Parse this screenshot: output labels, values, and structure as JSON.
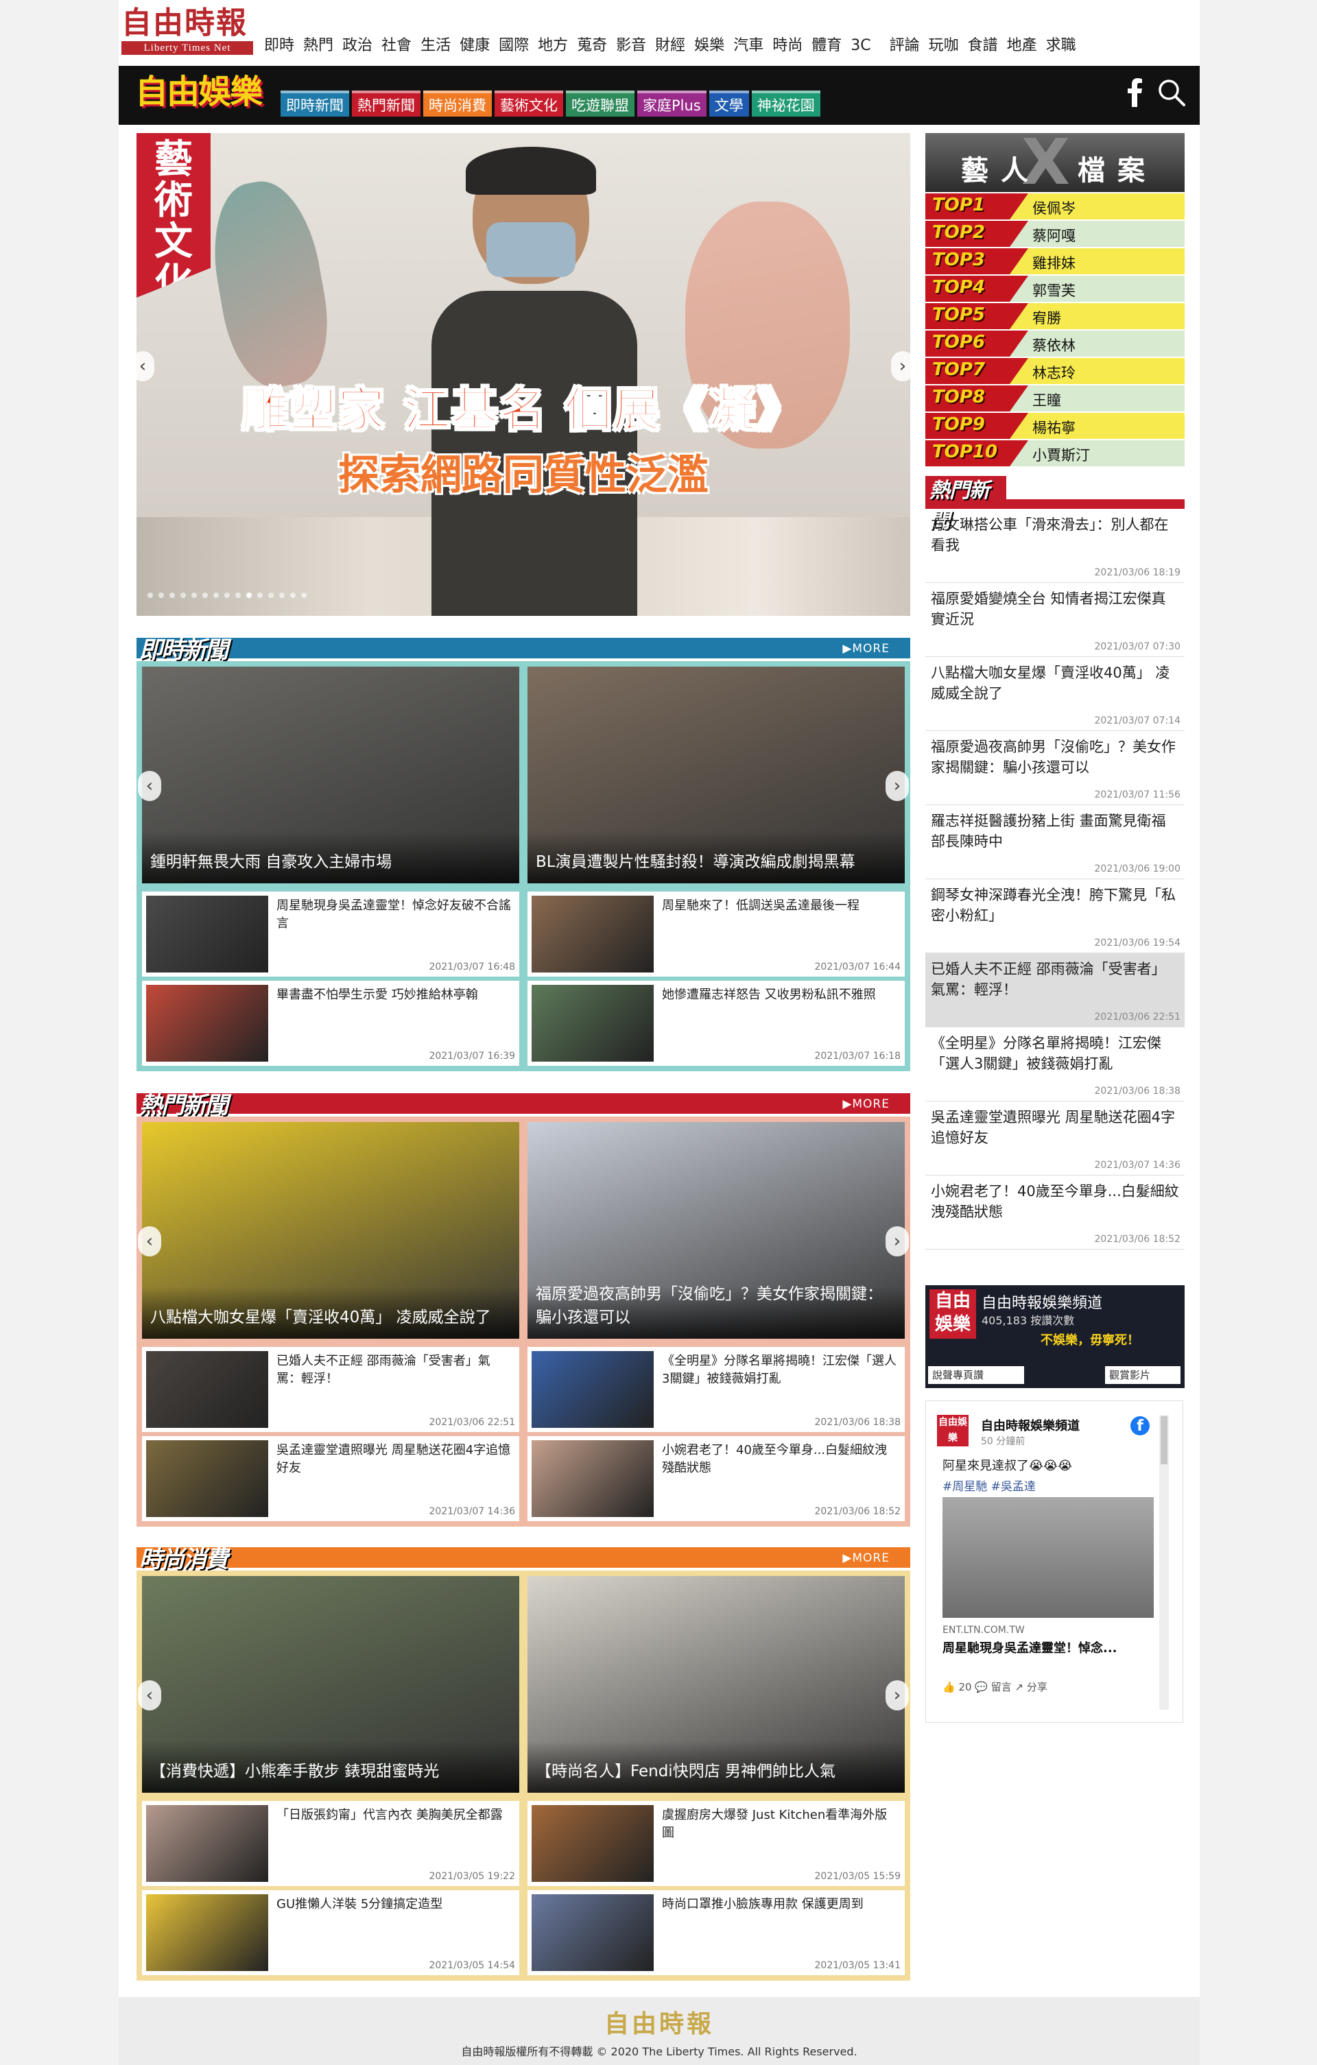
{
  "header": {
    "logo_text": "自由時報",
    "logo_sub": "Liberty Times Net",
    "nav": [
      "即時",
      "熱門",
      "政治",
      "社會",
      "生活",
      "健康",
      "國際",
      "地方",
      "蒐奇",
      "影音",
      "財經",
      "娛樂",
      "汽車",
      "時尚",
      "體育",
      "3C",
      "評論",
      "玩咖",
      "食譜",
      "地產",
      "求職"
    ]
  },
  "ent_bar": {
    "logo_text": "自由娛樂",
    "tabs": [
      {
        "label": "即時新聞",
        "color": "#1e7aa8"
      },
      {
        "label": "熱門新聞",
        "color": "#c41b2a"
      },
      {
        "label": "時尚消費",
        "color": "#f07a24"
      },
      {
        "label": "藝術文化",
        "color": "#c91c2c"
      },
      {
        "label": "吃遊聯盟",
        "color": "#2d8a5a"
      },
      {
        "label": "家庭Plus",
        "color": "#9a2a8a"
      },
      {
        "label": "文學",
        "color": "#1f5bb0"
      },
      {
        "label": "神祕花園",
        "color": "#1e9a74"
      }
    ]
  },
  "hero": {
    "badge": "藝術文化",
    "title_line1": "雕塑家 江基名 個展《凝》",
    "title_line2": "探索網路同質性泛濫",
    "dots_total": 15,
    "dots_active": 10
  },
  "artist_box": {
    "left": "藝人",
    "x": "X",
    "right": "檔案",
    "items": [
      {
        "rank": "TOP1",
        "name": "侯佩岑",
        "bg": "#f7ea4e"
      },
      {
        "rank": "TOP2",
        "name": "蔡阿嘎",
        "bg": "#d8ead0"
      },
      {
        "rank": "TOP3",
        "name": "雞排妹",
        "bg": "#f7ea4e"
      },
      {
        "rank": "TOP4",
        "name": "郭雪芙",
        "bg": "#d8ead0"
      },
      {
        "rank": "TOP5",
        "name": "宥勝",
        "bg": "#f7ea4e"
      },
      {
        "rank": "TOP6",
        "name": "蔡依林",
        "bg": "#d8ead0"
      },
      {
        "rank": "TOP7",
        "name": "林志玲",
        "bg": "#f7ea4e"
      },
      {
        "rank": "TOP8",
        "name": "王瞳",
        "bg": "#d8ead0"
      },
      {
        "rank": "TOP9",
        "name": "楊祐寧",
        "bg": "#f7ea4e"
      },
      {
        "rank": "TOP10",
        "name": "小賈斯汀",
        "bg": "#d8ead0"
      }
    ]
  },
  "hot_sidebar": {
    "title": "熱門新聞",
    "items": [
      {
        "t": "方文琳搭公車「滑來滑去」：別人都在看我",
        "d": "2021/03/06 18:19"
      },
      {
        "t": "福原愛婚變燒全台 知情者揭江宏傑真實近況",
        "d": "2021/03/07 07:30"
      },
      {
        "t": "八點檔大咖女星爆「賣淫收40萬」 凌威威全說了",
        "d": "2021/03/07 07:14"
      },
      {
        "t": "福原愛過夜高帥男「沒偷吃」？美女作家揭關鍵：騙小孩還可以",
        "d": "2021/03/07 11:56"
      },
      {
        "t": "羅志祥挺醫護扮豬上街 畫面驚見衛福部長陳時中",
        "d": "2021/03/06 19:00"
      },
      {
        "t": "鋼琴女神深蹲春光全洩！胯下驚見「私密小粉紅」",
        "d": "2021/03/06 19:54"
      },
      {
        "t": "已婚人夫不正經 邵雨薇淪「受害者」氣罵：輕浮！",
        "d": "2021/03/06 22:51"
      },
      {
        "t": "《全明星》分隊名單將揭曉！江宏傑「選人3關鍵」被錢薇娟打亂",
        "d": "2021/03/06 18:38"
      },
      {
        "t": "吳孟達靈堂遺照曝光 周星馳送花圈4字追憶好友",
        "d": "2021/03/07 14:36"
      },
      {
        "t": "小婉君老了！40歲至今單身...白髮細紋洩殘酷狀態",
        "d": "2021/03/06 18:52"
      }
    ]
  },
  "fb_widget": {
    "logo": "自由娛樂",
    "name": "自由時報娛樂頻道",
    "followers": "405,183 按讚次數",
    "slogan": "不娛樂，毋寧死！",
    "btn_left": "說聲專頁讚",
    "btn_right": "觀賞影片"
  },
  "fb_post": {
    "page": "自由時報娛樂頻道",
    "time": "50 分鐘前",
    "text": "阿星來見達叔了😭😭😭",
    "tags": "#周星馳  #吳孟達",
    "site": "ENT.LTN.COM.TW",
    "headline": "周星馳現身吳孟達靈堂！悼念...",
    "actions": "👍 20     💬 留言     ↗ 分享"
  },
  "sections": [
    {
      "name": "即時新聞",
      "more": "▶MORE",
      "color": "#1e7aa8",
      "bodybg": "#8dd2cc",
      "big": [
        {
          "t": "鍾明軒無畏大雨 自豪攻入主婦市場",
          "bg": "#6b6a65"
        },
        {
          "t": "BL演員遭製片性騷封殺！導演改編成劇揭黑幕",
          "bg": "#7d6d5e"
        }
      ],
      "small": [
        {
          "t": "周星馳現身吳孟達靈堂！悼念好友破不合謠言",
          "d": "2021/03/07 16:48",
          "bg": "#4a4a4a"
        },
        {
          "t": "周星馳來了！低調送吳孟達最後一程",
          "d": "2021/03/07 16:44",
          "bg": "#8a6a50"
        },
        {
          "t": "畢書盡不怕學生示愛 巧妙推給林亭翰",
          "d": "2021/03/07 16:39",
          "bg": "#c24a3a"
        },
        {
          "t": "她慘遭羅志祥怒告 又收男粉私訊不雅照",
          "d": "2021/03/07 16:18",
          "bg": "#5e7a5a"
        }
      ]
    },
    {
      "name": "熱門新聞",
      "more": "▶MORE",
      "color": "#c41b2a",
      "bodybg": "#efb9a6",
      "big": [
        {
          "t": "八點檔大咖女星爆「賣淫收40萬」 凌威威全說了",
          "bg": "#e7c82c"
        },
        {
          "t": "福原愛過夜高帥男「沒偷吃」？美女作家揭關鍵：騙小孩還可以",
          "bg": "#c9ced8"
        }
      ],
      "small": [
        {
          "t": "已婚人夫不正經 邵雨薇淪「受害者」氣罵：輕浮！",
          "d": "2021/03/06 22:51",
          "bg": "#4a4440"
        },
        {
          "t": "《全明星》分隊名單將揭曉！江宏傑「選人3關鍵」被錢薇娟打亂",
          "d": "2021/03/06 18:38",
          "bg": "#3a62a8"
        },
        {
          "t": "吳孟達靈堂遺照曝光 周星馳送花圈4字追憶好友",
          "d": "2021/03/07 14:36",
          "bg": "#7c6a3e"
        },
        {
          "t": "小婉君老了！40歲至今單身...白髮細紋洩殘酷狀態",
          "d": "2021/03/06 18:52",
          "bg": "#c4a08c"
        }
      ]
    },
    {
      "name": "時尚消費",
      "more": "▶MORE",
      "color": "#f07a24",
      "bodybg": "#f3dc9a",
      "big": [
        {
          "t": "【消費快遞】小熊牽手散步 錶現甜蜜時光",
          "bg": "#6d7b5c"
        },
        {
          "t": "【時尚名人】Fendi快閃店 男神們帥比人氣",
          "bg": "#d8d4cc"
        }
      ],
      "small": [
        {
          "t": "「日版張鈞甯」代言內衣 美胸美尻全都露",
          "d": "2021/03/05 19:22",
          "bg": "#b59a8e"
        },
        {
          "t": "虞握廚房大爆發 Just Kitchen看準海外版圖",
          "d": "2021/03/05 15:59",
          "bg": "#a2683a"
        },
        {
          "t": "GU推懶人洋裝 5分鐘搞定造型",
          "d": "2021/03/05 14:54",
          "bg": "#e8c43a"
        },
        {
          "t": "時尚口罩推小臉族專用款 保護更周到",
          "d": "2021/03/05 13:41",
          "bg": "#6a7aa0"
        }
      ]
    }
  ],
  "footer": {
    "logo": "自由時報",
    "copyright": "自由時報版權所有不得轉載 © 2020 The Liberty Times. All Rights Reserved."
  }
}
